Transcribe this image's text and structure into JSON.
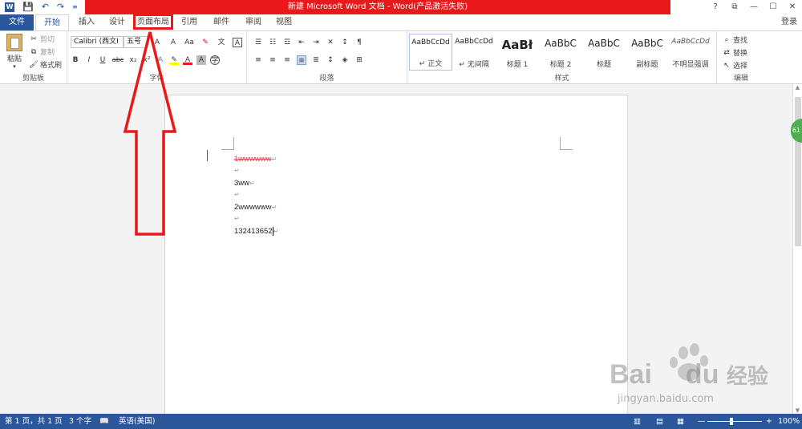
{
  "window": {
    "title": "新建 Microsoft Word 文档 - Word(产品激活失败)",
    "controls": [
      "?",
      "⧉",
      "—",
      "☐",
      "✕"
    ]
  },
  "tabs": [
    "文件",
    "开始",
    "插入",
    "设计",
    "页面布局",
    "引用",
    "邮件",
    "审阅",
    "视图"
  ],
  "login": "登录",
  "clipboard": {
    "paste": "粘贴",
    "cut": "剪切",
    "copy": "复制",
    "format_painter": "格式刷",
    "label": "剪贴板"
  },
  "font": {
    "name": "Calibri (西文正文)",
    "name_display": "Calibri (西文I",
    "size": "五号",
    "label": "字体",
    "buttons": [
      "B",
      "I",
      "U",
      "abc",
      "x₂",
      "x²"
    ]
  },
  "paragraph": {
    "label": "段落"
  },
  "styles": {
    "label": "样式",
    "items": [
      {
        "sample": "AaBbCcDd",
        "name": "↵ 正文"
      },
      {
        "sample": "AaBbCcDd",
        "name": "↵ 无间隔"
      },
      {
        "sample": "AaBł",
        "name": "标题 1"
      },
      {
        "sample": "AaBbC",
        "name": "标题 2"
      },
      {
        "sample": "AaBbC",
        "name": "标题"
      },
      {
        "sample": "AaBbC",
        "name": "副标题"
      },
      {
        "sample": "AaBbCcDd",
        "name": "不明显强调"
      }
    ]
  },
  "editing": {
    "find": "查找",
    "replace": "替换",
    "select": "选择",
    "label": "编辑"
  },
  "document": {
    "lines": [
      "1wwwwww",
      "3ww",
      "2wwwwww",
      "132413652"
    ]
  },
  "status": {
    "page": "第 1 页，共 1 页",
    "words": "3 个字",
    "language": "英语(美国)",
    "zoom": "100%"
  },
  "badge": "61",
  "watermark": {
    "brand": "Bai",
    "brand2": "du",
    "jingyan": "经验",
    "url": "jingyan.baidu.com"
  },
  "colors": {
    "word_blue": "#2b579a",
    "title_red": "#e8191b",
    "annotation_red": "#e8191b"
  }
}
